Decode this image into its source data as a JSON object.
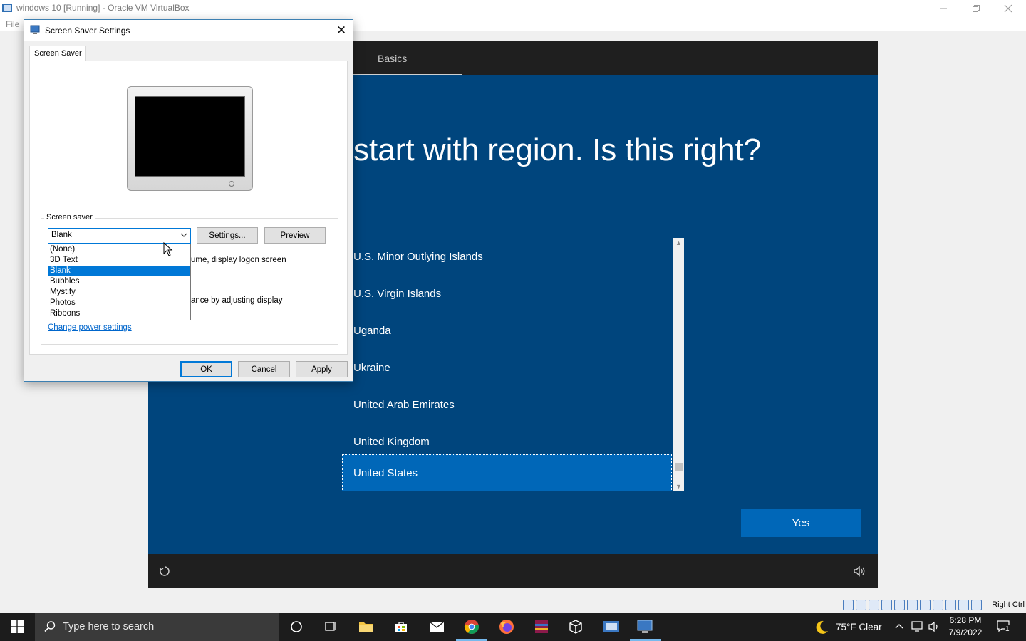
{
  "host": {
    "window_title": "windows 10 [Running] - Oracle VM VirtualBox",
    "menu_file": "File",
    "host_key": "Right Ctrl"
  },
  "oobe": {
    "tab_label": "Basics",
    "heading": "start with region. Is this right?",
    "regions": [
      "U.S. Minor Outlying Islands",
      "U.S. Virgin Islands",
      "Uganda",
      "Ukraine",
      "United Arab Emirates",
      "United Kingdom",
      "United States"
    ],
    "selected_region": "United States",
    "yes_label": "Yes"
  },
  "dialog": {
    "title": "Screen Saver Settings",
    "tab": "Screen Saver",
    "screensaver_group_label": "Screen saver",
    "selected_saver": "Blank",
    "saver_options": [
      "(None)",
      "3D Text",
      "Blank",
      "Bubbles",
      "Mystify",
      "Photos",
      "Ribbons"
    ],
    "settings_label": "Settings...",
    "preview_label": "Preview",
    "resume_text": "ume, display logon screen",
    "power_text": "ance by adjusting display",
    "power_link": "Change power settings",
    "ok_label": "OK",
    "cancel_label": "Cancel",
    "apply_label": "Apply"
  },
  "taskbar": {
    "search_placeholder": "Type here to search",
    "weather": "75°F  Clear",
    "time": "6:28 PM",
    "date": "7/9/2022",
    "notification_count": "1"
  },
  "colors": {
    "oobe_blue": "#00457d",
    "accent_blue": "#0067b8",
    "selection_blue": "#0078d7"
  }
}
